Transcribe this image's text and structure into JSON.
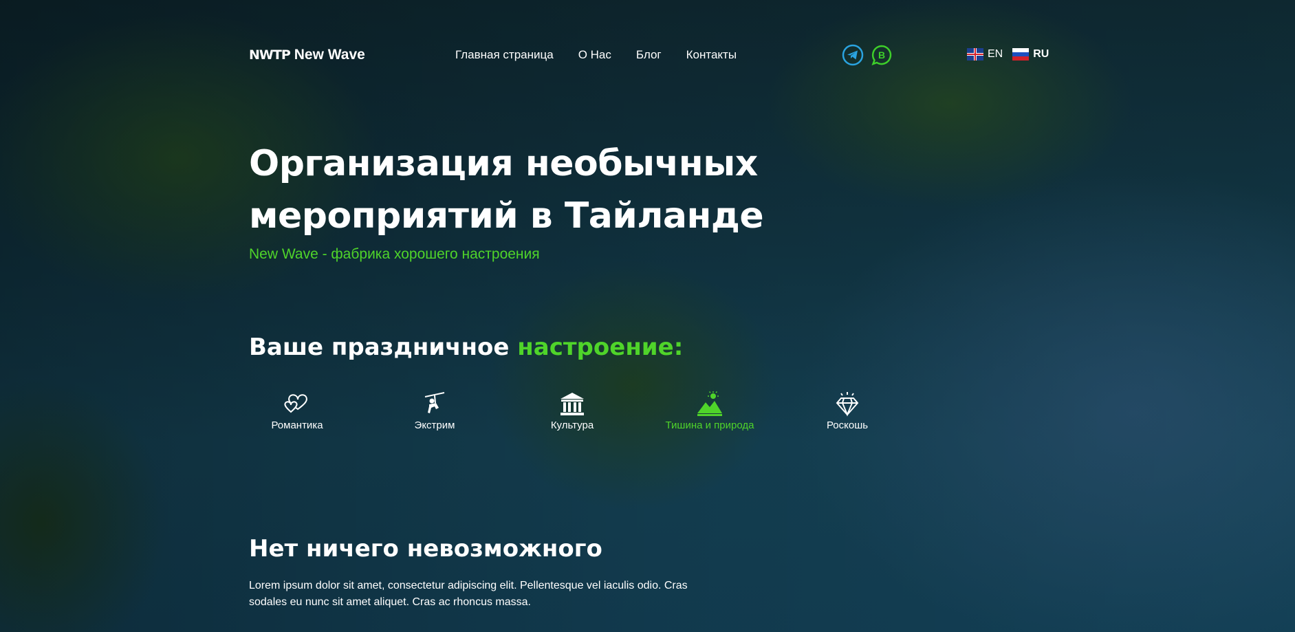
{
  "header": {
    "logo_mark": "NWTP",
    "logo_text": "New Wave",
    "nav": [
      {
        "label": "Главная страница"
      },
      {
        "label": "О Нас"
      },
      {
        "label": "Блог"
      },
      {
        "label": "Контакты"
      }
    ],
    "social": [
      {
        "icon": "telegram-icon",
        "color": "#2aa3e0"
      },
      {
        "icon": "whatsapp-business-icon",
        "color": "#3ecf2a"
      }
    ],
    "languages": [
      {
        "code": "EN",
        "icon": "uk-flag-icon",
        "active": false
      },
      {
        "code": "RU",
        "icon": "russia-flag-icon",
        "active": true
      }
    ]
  },
  "hero": {
    "title_line1": "Организация необычных",
    "title_line2": "мероприятий в Тайланде",
    "subtitle": "New Wave - фабрика хорошего настроения"
  },
  "mood": {
    "title_prefix": "Ваше праздничное ",
    "title_accent": "настроение:",
    "items": [
      {
        "label": "Романтика",
        "icon": "hearts-icon",
        "active": false
      },
      {
        "label": "Экстрим",
        "icon": "zipline-icon",
        "active": false
      },
      {
        "label": "Культура",
        "icon": "temple-icon",
        "active": false
      },
      {
        "label": "Тишина и природа",
        "icon": "landscape-icon",
        "active": true
      },
      {
        "label": "Роскошь",
        "icon": "diamond-icon",
        "active": false
      }
    ]
  },
  "section": {
    "title": "Нет ничего невозможного",
    "text": "Lorem ipsum dolor sit amet, consectetur adipiscing elit. Pellentesque vel iaculis odio. Cras sodales eu nunc sit amet aliquet. Cras ac rhoncus massa."
  },
  "colors": {
    "accent": "#4fd42a",
    "telegram": "#2aa3e0"
  }
}
